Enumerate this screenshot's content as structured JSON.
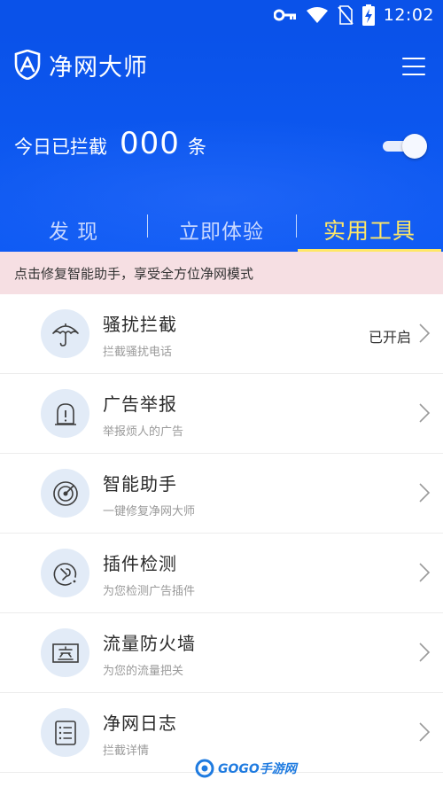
{
  "status_bar": {
    "time": "12:02",
    "icons": [
      "key-icon",
      "wifi-icon",
      "no-sim-icon",
      "battery-charging-icon"
    ]
  },
  "header": {
    "title": "净网大师",
    "logo_icon": "shield-logo-icon",
    "menu_icon": "menu-icon",
    "block_stats": {
      "prefix": "今日已拦截",
      "count": "000",
      "unit": "条"
    },
    "protection_toggle_on": true
  },
  "tabs": [
    {
      "label": "发 现",
      "active": false
    },
    {
      "label": "立即体验",
      "active": false
    },
    {
      "label": "实用工具",
      "active": true
    }
  ],
  "notice": {
    "text": "点击修复智能助手，享受全方位净网模式"
  },
  "tools": [
    {
      "name": "骚扰拦截",
      "desc": "拦截骚扰电话",
      "status": "已开启",
      "icon": "umbrella-icon"
    },
    {
      "name": "广告举报",
      "desc": "举报烦人的广告",
      "status": "",
      "icon": "alert-report-icon"
    },
    {
      "name": "智能助手",
      "desc": "一键修复净网大师",
      "status": "",
      "icon": "radar-icon"
    },
    {
      "name": "插件检测",
      "desc": "为您检测广告插件",
      "status": "",
      "icon": "plugin-scan-icon"
    },
    {
      "name": "流量防火墙",
      "desc": "为您的流量把关",
      "status": "",
      "icon": "firewall-icon"
    },
    {
      "name": "净网日志",
      "desc": "拦截详情",
      "status": "",
      "icon": "log-icon"
    }
  ],
  "watermark": {
    "text": "GOGO手游网"
  },
  "colors": {
    "header_blue": "#0a52e9",
    "active_tab": "#ffe766",
    "notice_bg": "#f6dfe3",
    "icon_bg": "#e2ebf7"
  }
}
